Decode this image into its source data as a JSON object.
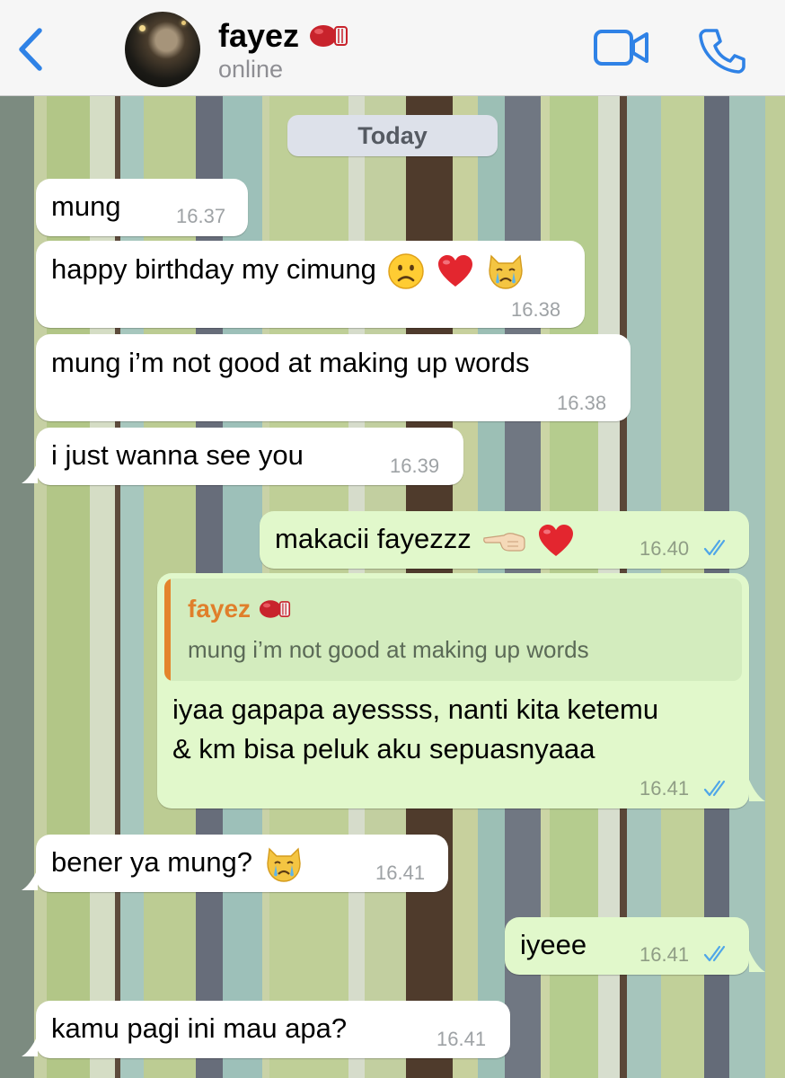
{
  "header": {
    "contact_name": "fayez",
    "contact_status": "online",
    "accent_color": "#2f82e6"
  },
  "date_divider": "Today",
  "messages": [
    {
      "direction": "in",
      "text": "mung",
      "time": "16.37"
    },
    {
      "direction": "in",
      "text": "happy birthday my cimung",
      "emoji": [
        "frowning-face",
        "red-heart",
        "crying-cat"
      ],
      "time": "16.38"
    },
    {
      "direction": "in",
      "text": "mung i’m not good at making up words",
      "time": "16.38"
    },
    {
      "direction": "in",
      "text": "i just wanna see you",
      "time": "16.39"
    },
    {
      "direction": "out",
      "text": "makacii fayezzz",
      "emoji": [
        "pointing-left-hand",
        "red-heart"
      ],
      "time": "16.40",
      "status": "read"
    },
    {
      "direction": "out",
      "reply_to": {
        "name": "fayez",
        "text": "mung i’m not good at making up words"
      },
      "lines": [
        "iyaa gapapa ayessss, nanti kita ketemu",
        "& km bisa peluk aku sepuasnyaaa"
      ],
      "time": "16.41",
      "status": "read"
    },
    {
      "direction": "in",
      "text": "bener ya mung?",
      "emoji": [
        "crying-cat"
      ],
      "time": "16.41"
    },
    {
      "direction": "out",
      "text": "iyeee",
      "time": "16.41",
      "status": "read"
    },
    {
      "direction": "in",
      "text": "kamu pagi ini mau apa?",
      "time": "16.41"
    }
  ]
}
